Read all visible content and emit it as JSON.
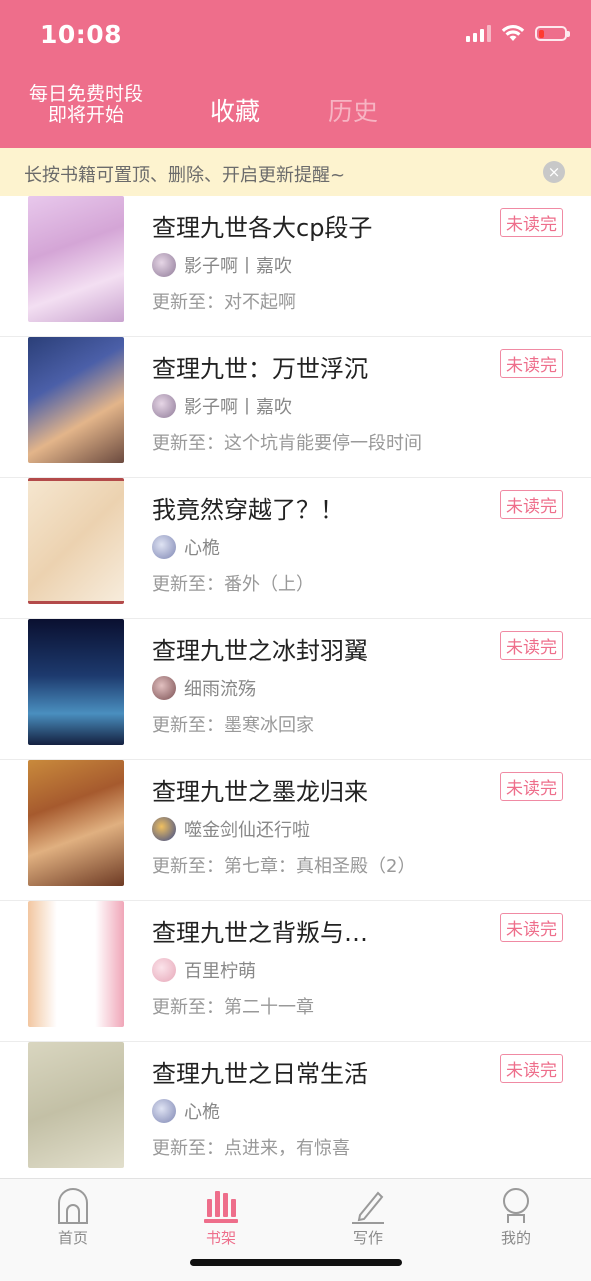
{
  "status_bar": {
    "time": "10:08"
  },
  "header": {
    "free_line1": "每日免费时段",
    "free_line2": "即将开始",
    "tab_favorites": "收藏",
    "tab_history": "历史"
  },
  "notice": {
    "text": "长按书籍可置顶、删除、开启更新提醒~",
    "close": "×"
  },
  "colors": {
    "brand": "#ee6e8b",
    "notice_bg": "#fdf3cf"
  },
  "books": [
    {
      "title": "查理九世各大cp段子",
      "author": "影子啊丨嘉吹",
      "update": "更新至：对不起啊",
      "badge": "未读完"
    },
    {
      "title": "查理九世：万世浮沉",
      "author": "影子啊丨嘉吹",
      "update": "更新至：这个坑肯能要停一段时间",
      "badge": "未读完"
    },
    {
      "title": "我竟然穿越了？！",
      "author": "心桅",
      "update": "更新至：番外（上）",
      "badge": "未读完"
    },
    {
      "title": "查理九世之冰封羽翼",
      "author": "细雨流殇",
      "update": "更新至：墨寒冰回家",
      "badge": "未读完"
    },
    {
      "title": "查理九世之墨龙归来",
      "author": "噬金剑仙还行啦",
      "update": "更新至：第七章：真相圣殿（2）",
      "badge": "未读完"
    },
    {
      "title": "查理九世之背叛与…",
      "author": "百里柠萌",
      "update": "更新至：第二十一章",
      "badge": "未读完"
    },
    {
      "title": "查理九世之日常生活",
      "author": "心桅",
      "update": "更新至：点进来，有惊喜",
      "badge": "未读完"
    }
  ],
  "tabbar": {
    "home": "首页",
    "shelf": "书架",
    "write": "写作",
    "mine": "我的"
  }
}
